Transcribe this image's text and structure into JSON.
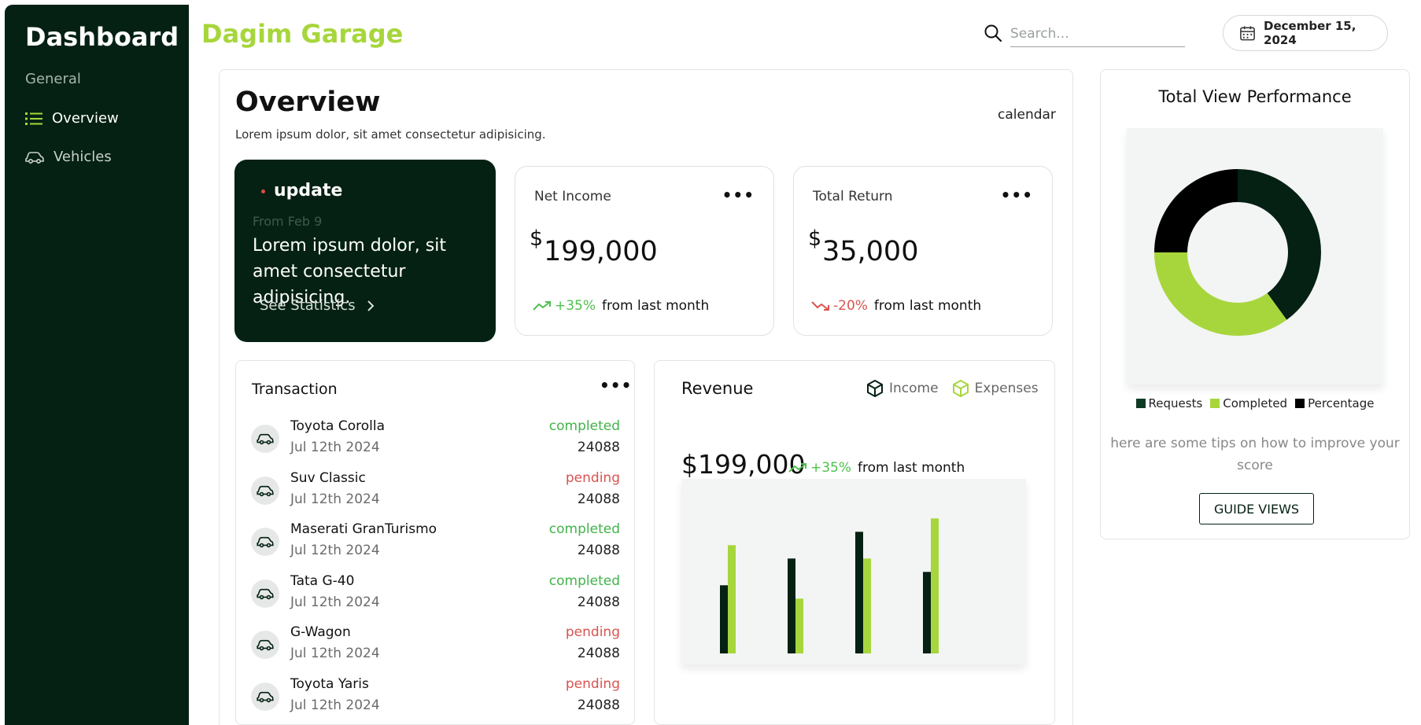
{
  "sidebar": {
    "brand": "Dashboard",
    "section": "General",
    "items": [
      {
        "label": "Overview",
        "icon": "list-icon"
      },
      {
        "label": "Vehicles",
        "icon": "car-icon"
      }
    ]
  },
  "header": {
    "title": "Dagim Garage",
    "search_placeholder": "Search...",
    "date": "December 15, 2024"
  },
  "overview": {
    "title": "Overview",
    "subtitle": "Lorem ipsum dolor, sit amet consectetur adipisicing.",
    "calendar_link": "calendar"
  },
  "update_card": {
    "title": "update",
    "date": "From Feb 9",
    "text": "Lorem ipsum dolor, sit amet consectetur adipisicing.",
    "link": "See Statistics"
  },
  "stats": [
    {
      "label": "Net Income",
      "currency": "$",
      "value": "199,000",
      "trend": "+35%",
      "trend_dir": "up",
      "trend_suffix": "from last month"
    },
    {
      "label": "Total Return",
      "currency": "$",
      "value": "35,000",
      "trend": "-20%",
      "trend_dir": "down",
      "trend_suffix": "from last month"
    }
  ],
  "transactions": {
    "title": "Transaction",
    "rows": [
      {
        "name": "Toyota Corolla",
        "date": "Jul 12th 2024",
        "status": "completed",
        "amount": "24088"
      },
      {
        "name": "Suv Classic",
        "date": "Jul 12th 2024",
        "status": "pending",
        "amount": "24088"
      },
      {
        "name": "Maserati GranTurismo",
        "date": "Jul 12th 2024",
        "status": "completed",
        "amount": "24088"
      },
      {
        "name": "Tata G-40",
        "date": "Jul 12th 2024",
        "status": "completed",
        "amount": "24088"
      },
      {
        "name": "G-Wagon",
        "date": "Jul 12th 2024",
        "status": "pending",
        "amount": "24088"
      },
      {
        "name": "Toyota Yaris",
        "date": "Jul 12th 2024",
        "status": "pending",
        "amount": "24088"
      }
    ]
  },
  "revenue": {
    "title": "Revenue",
    "legend_income": "Income",
    "legend_expenses": "Expenses",
    "value": "$199,000",
    "trend": "+35%",
    "trend_suffix": "from last month"
  },
  "performance": {
    "title": "Total View Performance",
    "legend": [
      "Requests",
      "Completed",
      "Percentage"
    ],
    "tips": "here are some tips on how to improve your score",
    "button": "GUIDE VIEWS"
  },
  "colors": {
    "dark": "#042113",
    "lime": "#a7d63c",
    "black": "#000000",
    "up": "#4ec24e",
    "down": "#d9534f"
  },
  "chart_data": [
    {
      "type": "bar",
      "series": [
        {
          "values": [
            51,
            71,
            91,
            61
          ]
        },
        {
          "values": [
            81,
            41,
            71,
            101
          ]
        }
      ]
    },
    {
      "type": "pie",
      "labels": [
        "Requests",
        "Completed",
        "Percentage"
      ],
      "values": [
        40,
        35,
        25
      ]
    }
  ]
}
